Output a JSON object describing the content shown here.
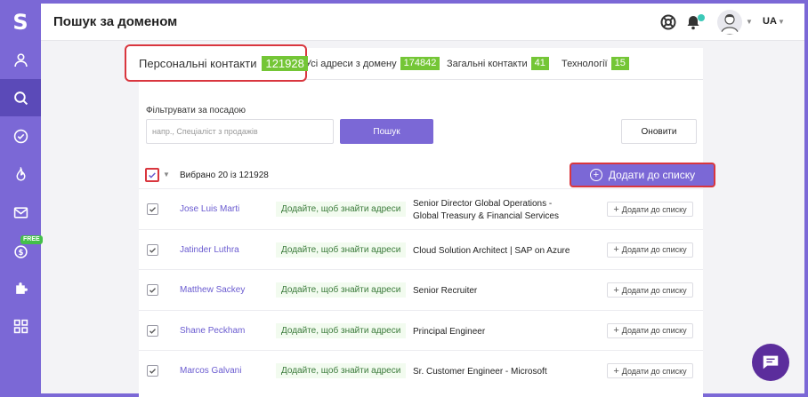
{
  "app": {
    "logo_letter": "S",
    "page_title": "Пошук за доменом",
    "language": "UA"
  },
  "sidebar": {
    "items": [
      {
        "name": "contacts",
        "icon": "person-icon"
      },
      {
        "name": "search",
        "icon": "search-icon",
        "active": true
      },
      {
        "name": "verify",
        "icon": "check-circle-icon"
      },
      {
        "name": "warmup",
        "icon": "flame-icon"
      },
      {
        "name": "email",
        "icon": "mail-icon"
      },
      {
        "name": "credits",
        "icon": "dollar-icon",
        "badge": "FREE"
      },
      {
        "name": "integrations",
        "icon": "puzzle-icon"
      },
      {
        "name": "apps",
        "icon": "grid-icon"
      }
    ]
  },
  "tabs": [
    {
      "label": "Персональні контакти",
      "count": "121928",
      "active": true
    },
    {
      "label": "Усі адреси з домену",
      "count": "174842"
    },
    {
      "label": "Загальні контакти",
      "count": "41"
    },
    {
      "label": "Технології",
      "count": "15"
    }
  ],
  "filter": {
    "label": "Фільтрувати за посадою",
    "placeholder": "напр., Спеціаліст з продажів",
    "search_button": "Пошук",
    "refresh_button": "Оновити"
  },
  "selection": {
    "text": "Вибрано 20 із 121928",
    "add_button": "Додати до списку"
  },
  "rows": [
    {
      "name": "Jose Luis Marti",
      "address_hint": "Додайте, щоб знайти адреси",
      "position": "Senior Director Global Operations - Global Treasury & Financial Services",
      "add": "Додати до списку",
      "checked": true
    },
    {
      "name": "Jatinder Luthra",
      "address_hint": "Додайте, щоб знайти адреси",
      "position": "Cloud Solution Architect | SAP on Azure",
      "add": "Додати до списку",
      "checked": true
    },
    {
      "name": "Matthew Sackey",
      "address_hint": "Додайте, щоб знайти адреси",
      "position": "Senior Recruiter",
      "add": "Додати до списку",
      "checked": true
    },
    {
      "name": "Shane Peckham",
      "address_hint": "Додайте, щоб знайти адреси",
      "position": "Principal Engineer",
      "add": "Додати до списку",
      "checked": true
    },
    {
      "name": "Marcos Galvani",
      "address_hint": "Додайте, щоб знайти адреси",
      "position": "Sr. Customer Engineer - Microsoft",
      "add": "Додати до списку",
      "checked": true
    }
  ],
  "colors": {
    "brand": "#7b68d6",
    "count_badge": "#74c636",
    "highlight": "#d9363e",
    "link": "#6a5bd0"
  }
}
